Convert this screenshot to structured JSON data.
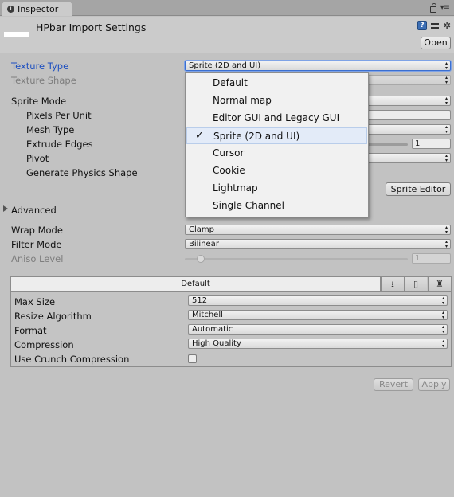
{
  "tab": {
    "label": "Inspector"
  },
  "header": {
    "title": "HPbar Import Settings",
    "open_button": "Open"
  },
  "texture_type": {
    "label": "Texture Type",
    "value": "Sprite (2D and UI)"
  },
  "texture_shape": {
    "label": "Texture Shape"
  },
  "sprite_mode": {
    "label": "Sprite Mode"
  },
  "pixels_per_unit": {
    "label": "Pixels Per Unit"
  },
  "mesh_type": {
    "label": "Mesh Type"
  },
  "extrude_edges": {
    "label": "Extrude Edges",
    "value": "1"
  },
  "pivot": {
    "label": "Pivot"
  },
  "generate_physics_shape": {
    "label": "Generate Physics Shape"
  },
  "sprite_editor_button": "Sprite Editor",
  "advanced": {
    "label": "Advanced"
  },
  "wrap_mode": {
    "label": "Wrap Mode",
    "value": "Clamp"
  },
  "filter_mode": {
    "label": "Filter Mode",
    "value": "Bilinear"
  },
  "aniso_level": {
    "label": "Aniso Level",
    "value": "1"
  },
  "texture_type_menu": {
    "items": [
      "Default",
      "Normal map",
      "Editor GUI and Legacy GUI",
      "Sprite (2D and UI)",
      "Cursor",
      "Cookie",
      "Lightmap",
      "Single Channel"
    ],
    "selected_index": 3,
    "check_glyph": "✓"
  },
  "platform": {
    "default_tab": "Default",
    "max_size": {
      "label": "Max Size",
      "value": "512"
    },
    "resize_algorithm": {
      "label": "Resize Algorithm",
      "value": "Mitchell"
    },
    "format": {
      "label": "Format",
      "value": "Automatic"
    },
    "compression": {
      "label": "Compression",
      "value": "High Quality"
    },
    "use_crunch_compression": {
      "label": "Use Crunch Compression",
      "checked": false
    }
  },
  "footer": {
    "revert": "Revert",
    "apply": "Apply"
  },
  "colors": {
    "blue_label": "#1d4fc0",
    "menu_selected_bg": "#e3ebf8"
  },
  "icons": [
    "inspector-icon",
    "lock-icon",
    "menu-icon",
    "help-icon",
    "preset-icon",
    "gear-icon",
    "foldout-icon",
    "check-icon",
    "download-icon",
    "phone-icon",
    "android-icon"
  ]
}
